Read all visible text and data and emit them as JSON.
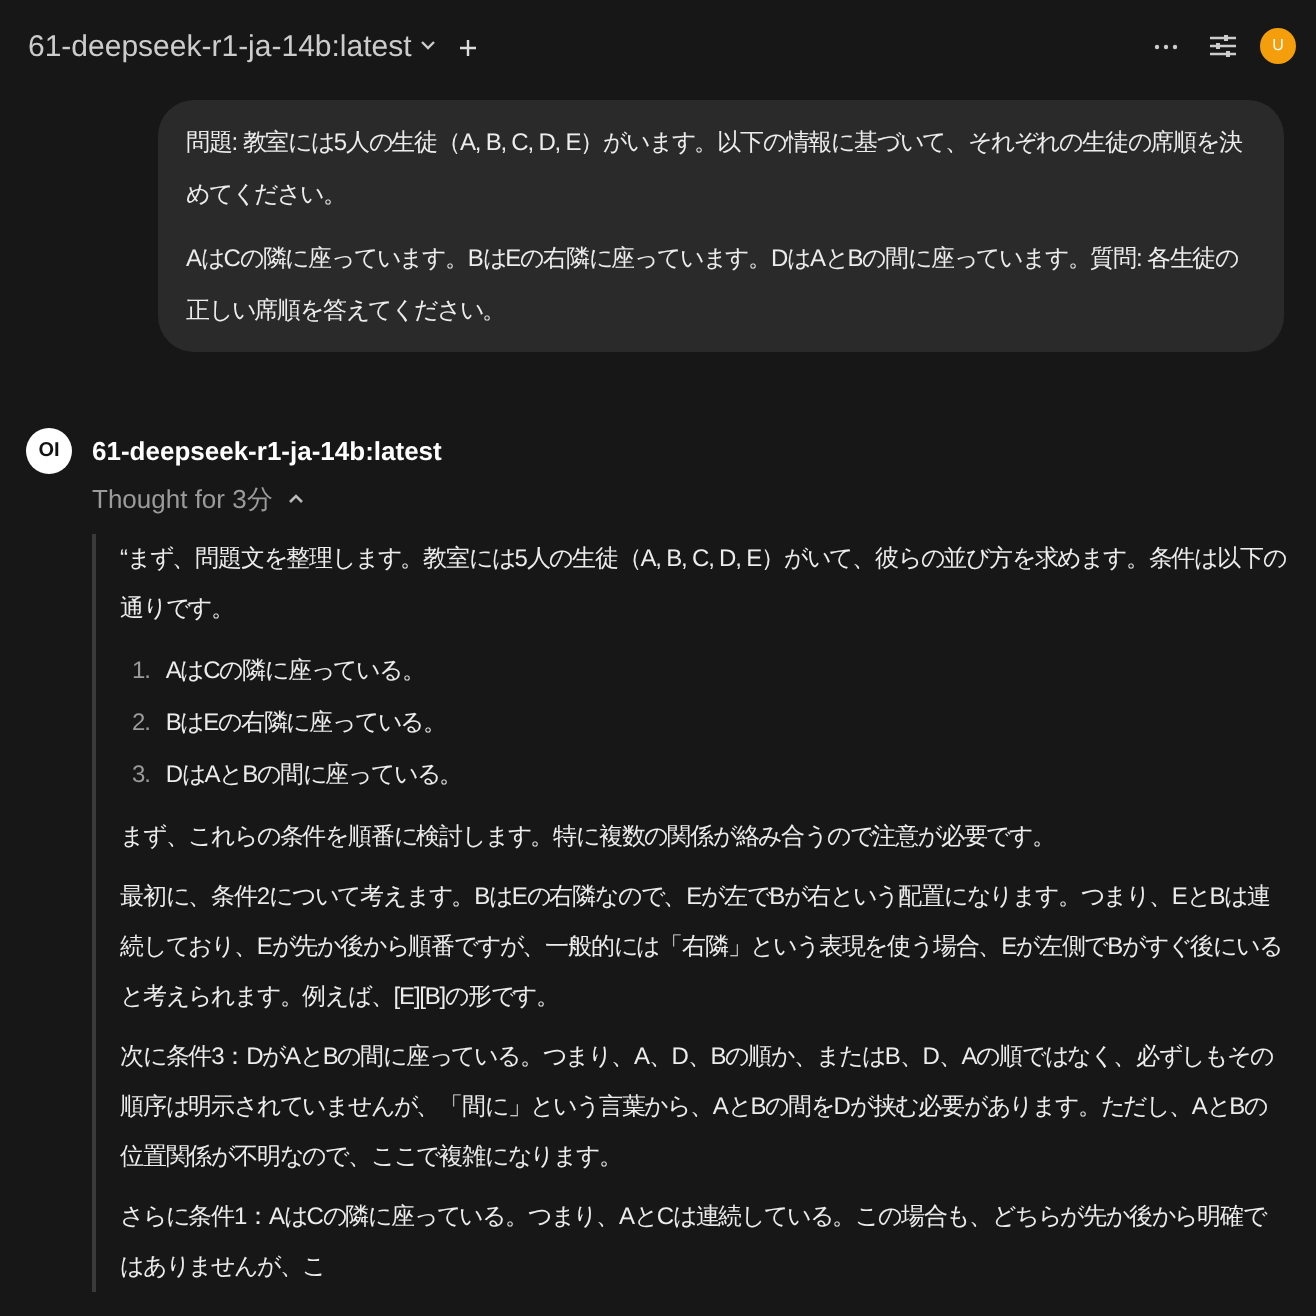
{
  "header": {
    "model_name": "61-deepseek-r1-ja-14b:latest",
    "avatar_letter": "U"
  },
  "user_message": {
    "paragraphs": [
      "問題: 教室には5人の生徒（A, B, C, D, E）がいます。以下の情報に基づいて、それぞれの生徒の席順を決めてください。",
      "AはCの隣に座っています。BはEの右隣に座っています。DはAとBの間に座っています。質問: 各生徒の正しい席順を答えてください。"
    ]
  },
  "assistant_message": {
    "avatar_text": "OI",
    "model_name": "61-deepseek-r1-ja-14b:latest",
    "thought_label": "Thought for 3分",
    "expanded": true,
    "blocks": [
      {
        "kind": "paragraph",
        "text": "“まず、問題文を整理します。教室には5人の生徒（A, B, C, D, E）がいて、彼らの並び方を求めます。条件は以下の通りです。"
      },
      {
        "kind": "list",
        "items": [
          {
            "number": "1.",
            "text": "AはCの隣に座っている。"
          },
          {
            "number": "2.",
            "text": "BはEの右隣に座っている。"
          },
          {
            "number": "3.",
            "text": "DはAとBの間に座っている。"
          }
        ]
      },
      {
        "kind": "paragraph",
        "text": "まず、これらの条件を順番に検討します。特に複数の関係が絡み合うので注意が必要です。"
      },
      {
        "kind": "paragraph",
        "text": "最初に、条件2について考えます。BはEの右隣なので、Eが左でBが右という配置になります。つまり、EとBは連続しており、Eが先か後から順番ですが、一般的には「右隣」という表現を使う場合、Eが左側でBがすぐ後にいると考えられます。例えば、[E][B]の形です。"
      },
      {
        "kind": "paragraph",
        "text": "次に条件3：DがAとBの間に座っている。つまり、A、D、Bの順か、またはB、D、Aの順ではなく、必ずしもその順序は明示されていませんが、「間に」という言葉から、AとBの間をDが挟む必要があります。ただし、AとBの位置関係が不明なので、ここで複雑になります。"
      },
      {
        "kind": "paragraph",
        "text": "さらに条件1：AはCの隣に座っている。つまり、AとCは連続している。この場合も、どちらが先か後から明確ではありませんが、こ"
      }
    ]
  }
}
